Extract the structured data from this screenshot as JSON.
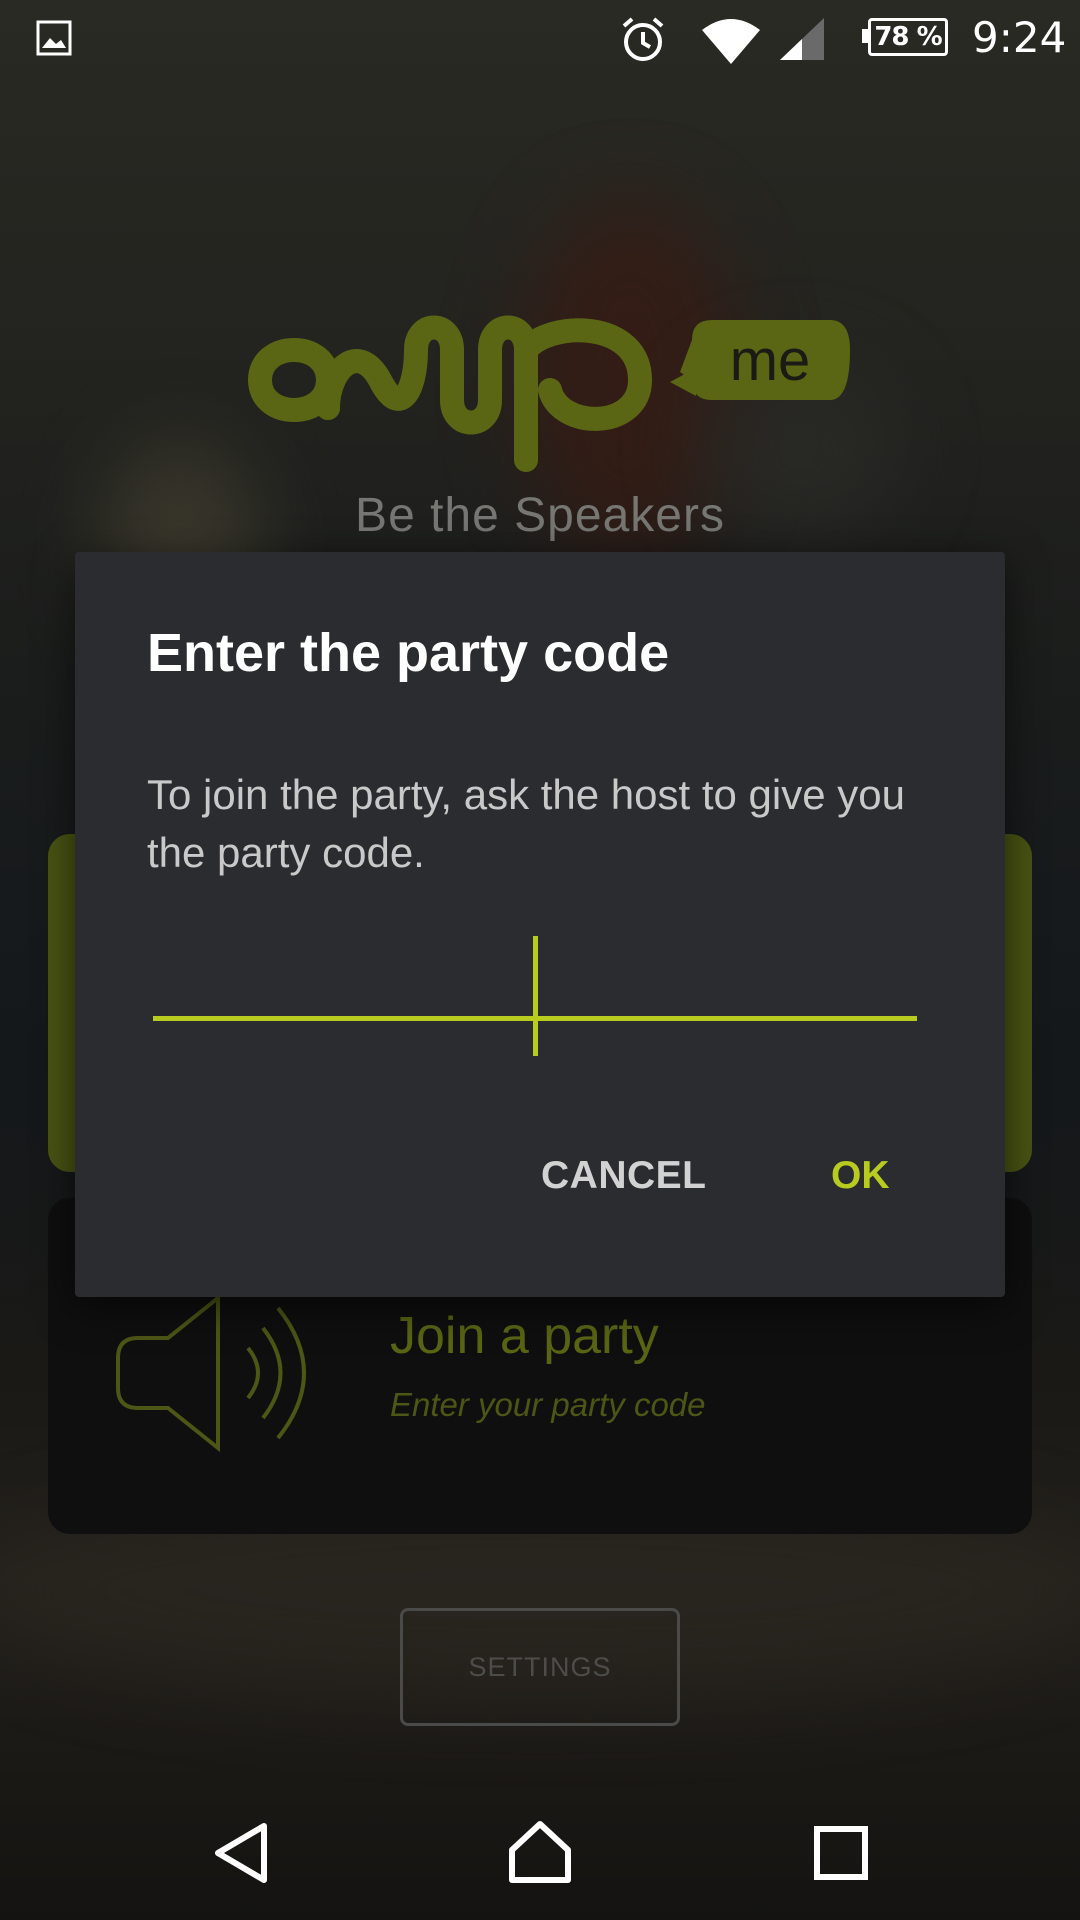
{
  "status_bar": {
    "gallery_icon": "image-icon",
    "alarm_icon": "alarm-icon",
    "wifi_icon": "wifi-icon",
    "signal_icon": "cell-signal-icon",
    "battery_label": "78 %",
    "battery_level": 0.78,
    "time": "9:24"
  },
  "logo": {
    "wordmark": "amp",
    "badge": "me",
    "color": "#5a6614"
  },
  "tagline": "Be the Speakers",
  "join_card": {
    "title": "Join a party",
    "subtitle": "Enter your party code"
  },
  "settings_button": "SETTINGS",
  "dialog": {
    "title": "Enter the party code",
    "message": "To join the party, ask the host to give you the party code.",
    "input_value": "",
    "cancel_label": "CANCEL",
    "ok_label": "OK",
    "accent_color": "#b8cc20"
  },
  "nav_bar": {
    "back_icon": "back-triangle-icon",
    "home_icon": "home-icon",
    "recents_icon": "recents-square-icon"
  }
}
